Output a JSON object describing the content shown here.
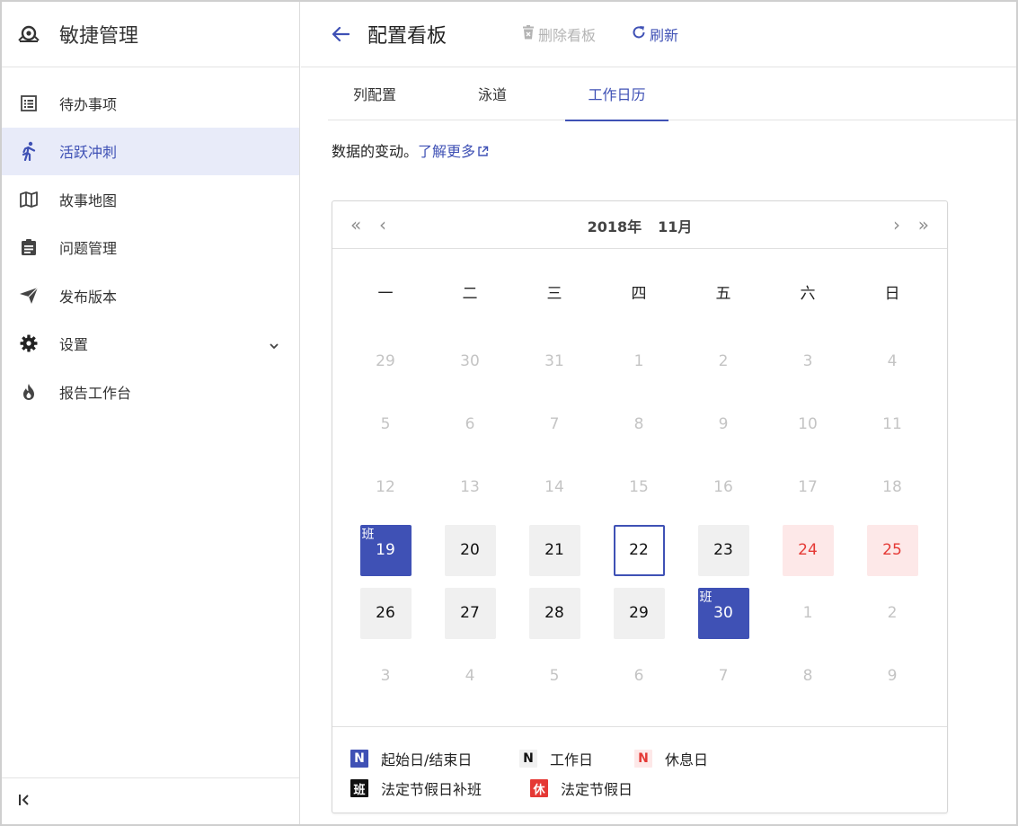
{
  "sidebar": {
    "brand": "敏捷管理",
    "items": [
      {
        "label": "待办事项"
      },
      {
        "label": "活跃冲刺"
      },
      {
        "label": "故事地图"
      },
      {
        "label": "问题管理"
      },
      {
        "label": "发布版本"
      },
      {
        "label": "设置"
      },
      {
        "label": "报告工作台"
      }
    ],
    "active_index": 1
  },
  "topbar": {
    "title": "配置看板",
    "delete_label": "删除看板",
    "refresh_label": "刷新"
  },
  "tabs": [
    "列配置",
    "泳道",
    "工作日历"
  ],
  "active_tab": 2,
  "description": {
    "text": "数据的变动。",
    "link": "了解更多"
  },
  "calendar": {
    "year_label": "2018年",
    "month_label": "11月",
    "prev_year": "«",
    "prev_month": "‹",
    "next_month": "›",
    "next_year": "»",
    "weekdays": [
      "一",
      "二",
      "三",
      "四",
      "五",
      "六",
      "日"
    ],
    "days": [
      [
        {
          "d": "29",
          "t": "muted"
        },
        {
          "d": "30",
          "t": "muted"
        },
        {
          "d": "31",
          "t": "muted"
        },
        {
          "d": "1",
          "t": "muted"
        },
        {
          "d": "2",
          "t": "muted"
        },
        {
          "d": "3",
          "t": "muted"
        },
        {
          "d": "4",
          "t": "muted"
        }
      ],
      [
        {
          "d": "5",
          "t": "muted"
        },
        {
          "d": "6",
          "t": "muted"
        },
        {
          "d": "7",
          "t": "muted"
        },
        {
          "d": "8",
          "t": "muted"
        },
        {
          "d": "9",
          "t": "muted"
        },
        {
          "d": "10",
          "t": "muted"
        },
        {
          "d": "11",
          "t": "muted"
        }
      ],
      [
        {
          "d": "12",
          "t": "muted"
        },
        {
          "d": "13",
          "t": "muted"
        },
        {
          "d": "14",
          "t": "muted"
        },
        {
          "d": "15",
          "t": "muted"
        },
        {
          "d": "16",
          "t": "muted"
        },
        {
          "d": "17",
          "t": "muted"
        },
        {
          "d": "18",
          "t": "muted"
        }
      ],
      [
        {
          "d": "19",
          "t": "startend",
          "tag": "班"
        },
        {
          "d": "20",
          "t": "work"
        },
        {
          "d": "21",
          "t": "work"
        },
        {
          "d": "22",
          "t": "today"
        },
        {
          "d": "23",
          "t": "work"
        },
        {
          "d": "24",
          "t": "rest"
        },
        {
          "d": "25",
          "t": "rest"
        }
      ],
      [
        {
          "d": "26",
          "t": "work"
        },
        {
          "d": "27",
          "t": "work"
        },
        {
          "d": "28",
          "t": "work"
        },
        {
          "d": "29",
          "t": "work"
        },
        {
          "d": "30",
          "t": "startend",
          "tag": "班"
        },
        {
          "d": "1",
          "t": "muted"
        },
        {
          "d": "2",
          "t": "muted"
        }
      ],
      [
        {
          "d": "3",
          "t": "muted"
        },
        {
          "d": "4",
          "t": "muted"
        },
        {
          "d": "5",
          "t": "muted"
        },
        {
          "d": "6",
          "t": "muted"
        },
        {
          "d": "7",
          "t": "muted"
        },
        {
          "d": "8",
          "t": "muted"
        },
        {
          "d": "9",
          "t": "muted"
        }
      ]
    ]
  },
  "legend": [
    {
      "symbol": "N",
      "label": "起始日/结束日",
      "style": "blue"
    },
    {
      "symbol": "N",
      "label": "工作日",
      "style": "gray"
    },
    {
      "symbol": "N",
      "label": "休息日",
      "style": "pink"
    },
    {
      "symbol": "班",
      "label": "法定节假日补班",
      "style": "black"
    },
    {
      "symbol": "休",
      "label": "法定节假日",
      "style": "red"
    }
  ],
  "colors": {
    "accent": "#3f51b5",
    "rest_text": "#e53935",
    "rest_bg": "#fde8e8",
    "work_bg": "#f0f0f0"
  },
  "icons": {
    "brand": "agile-logo-icon",
    "items": [
      "list-icon",
      "run-icon",
      "map-icon",
      "clipboard-icon",
      "send-icon",
      "gear-icon",
      "fire-icon"
    ]
  }
}
